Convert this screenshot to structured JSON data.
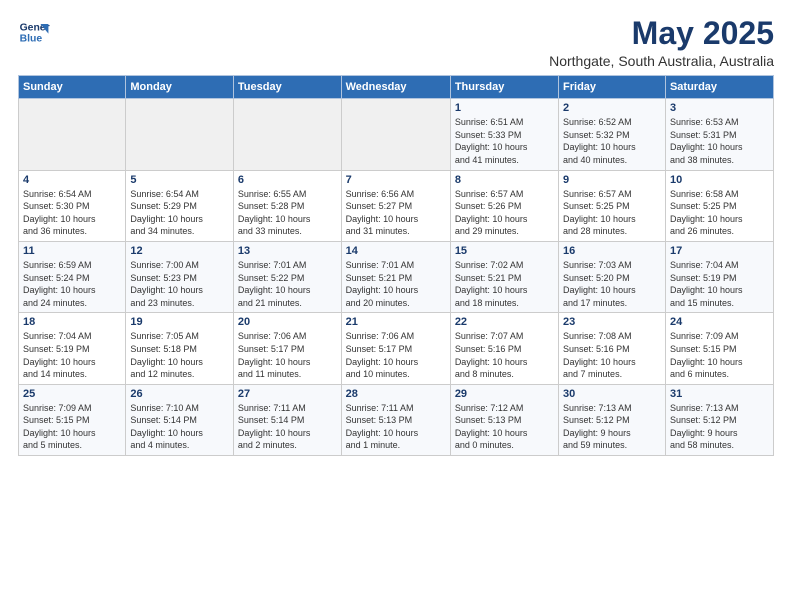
{
  "header": {
    "logo_line1": "General",
    "logo_line2": "Blue",
    "title": "May 2025",
    "subtitle": "Northgate, South Australia, Australia"
  },
  "days_of_week": [
    "Sunday",
    "Monday",
    "Tuesday",
    "Wednesday",
    "Thursday",
    "Friday",
    "Saturday"
  ],
  "weeks": [
    [
      {
        "day": "",
        "info": ""
      },
      {
        "day": "",
        "info": ""
      },
      {
        "day": "",
        "info": ""
      },
      {
        "day": "",
        "info": ""
      },
      {
        "day": "1",
        "info": "Sunrise: 6:51 AM\nSunset: 5:33 PM\nDaylight: 10 hours\nand 41 minutes."
      },
      {
        "day": "2",
        "info": "Sunrise: 6:52 AM\nSunset: 5:32 PM\nDaylight: 10 hours\nand 40 minutes."
      },
      {
        "day": "3",
        "info": "Sunrise: 6:53 AM\nSunset: 5:31 PM\nDaylight: 10 hours\nand 38 minutes."
      }
    ],
    [
      {
        "day": "4",
        "info": "Sunrise: 6:54 AM\nSunset: 5:30 PM\nDaylight: 10 hours\nand 36 minutes."
      },
      {
        "day": "5",
        "info": "Sunrise: 6:54 AM\nSunset: 5:29 PM\nDaylight: 10 hours\nand 34 minutes."
      },
      {
        "day": "6",
        "info": "Sunrise: 6:55 AM\nSunset: 5:28 PM\nDaylight: 10 hours\nand 33 minutes."
      },
      {
        "day": "7",
        "info": "Sunrise: 6:56 AM\nSunset: 5:27 PM\nDaylight: 10 hours\nand 31 minutes."
      },
      {
        "day": "8",
        "info": "Sunrise: 6:57 AM\nSunset: 5:26 PM\nDaylight: 10 hours\nand 29 minutes."
      },
      {
        "day": "9",
        "info": "Sunrise: 6:57 AM\nSunset: 5:25 PM\nDaylight: 10 hours\nand 28 minutes."
      },
      {
        "day": "10",
        "info": "Sunrise: 6:58 AM\nSunset: 5:25 PM\nDaylight: 10 hours\nand 26 minutes."
      }
    ],
    [
      {
        "day": "11",
        "info": "Sunrise: 6:59 AM\nSunset: 5:24 PM\nDaylight: 10 hours\nand 24 minutes."
      },
      {
        "day": "12",
        "info": "Sunrise: 7:00 AM\nSunset: 5:23 PM\nDaylight: 10 hours\nand 23 minutes."
      },
      {
        "day": "13",
        "info": "Sunrise: 7:01 AM\nSunset: 5:22 PM\nDaylight: 10 hours\nand 21 minutes."
      },
      {
        "day": "14",
        "info": "Sunrise: 7:01 AM\nSunset: 5:21 PM\nDaylight: 10 hours\nand 20 minutes."
      },
      {
        "day": "15",
        "info": "Sunrise: 7:02 AM\nSunset: 5:21 PM\nDaylight: 10 hours\nand 18 minutes."
      },
      {
        "day": "16",
        "info": "Sunrise: 7:03 AM\nSunset: 5:20 PM\nDaylight: 10 hours\nand 17 minutes."
      },
      {
        "day": "17",
        "info": "Sunrise: 7:04 AM\nSunset: 5:19 PM\nDaylight: 10 hours\nand 15 minutes."
      }
    ],
    [
      {
        "day": "18",
        "info": "Sunrise: 7:04 AM\nSunset: 5:19 PM\nDaylight: 10 hours\nand 14 minutes."
      },
      {
        "day": "19",
        "info": "Sunrise: 7:05 AM\nSunset: 5:18 PM\nDaylight: 10 hours\nand 12 minutes."
      },
      {
        "day": "20",
        "info": "Sunrise: 7:06 AM\nSunset: 5:17 PM\nDaylight: 10 hours\nand 11 minutes."
      },
      {
        "day": "21",
        "info": "Sunrise: 7:06 AM\nSunset: 5:17 PM\nDaylight: 10 hours\nand 10 minutes."
      },
      {
        "day": "22",
        "info": "Sunrise: 7:07 AM\nSunset: 5:16 PM\nDaylight: 10 hours\nand 8 minutes."
      },
      {
        "day": "23",
        "info": "Sunrise: 7:08 AM\nSunset: 5:16 PM\nDaylight: 10 hours\nand 7 minutes."
      },
      {
        "day": "24",
        "info": "Sunrise: 7:09 AM\nSunset: 5:15 PM\nDaylight: 10 hours\nand 6 minutes."
      }
    ],
    [
      {
        "day": "25",
        "info": "Sunrise: 7:09 AM\nSunset: 5:15 PM\nDaylight: 10 hours\nand 5 minutes."
      },
      {
        "day": "26",
        "info": "Sunrise: 7:10 AM\nSunset: 5:14 PM\nDaylight: 10 hours\nand 4 minutes."
      },
      {
        "day": "27",
        "info": "Sunrise: 7:11 AM\nSunset: 5:14 PM\nDaylight: 10 hours\nand 2 minutes."
      },
      {
        "day": "28",
        "info": "Sunrise: 7:11 AM\nSunset: 5:13 PM\nDaylight: 10 hours\nand 1 minute."
      },
      {
        "day": "29",
        "info": "Sunrise: 7:12 AM\nSunset: 5:13 PM\nDaylight: 10 hours\nand 0 minutes."
      },
      {
        "day": "30",
        "info": "Sunrise: 7:13 AM\nSunset: 5:12 PM\nDaylight: 9 hours\nand 59 minutes."
      },
      {
        "day": "31",
        "info": "Sunrise: 7:13 AM\nSunset: 5:12 PM\nDaylight: 9 hours\nand 58 minutes."
      }
    ]
  ]
}
